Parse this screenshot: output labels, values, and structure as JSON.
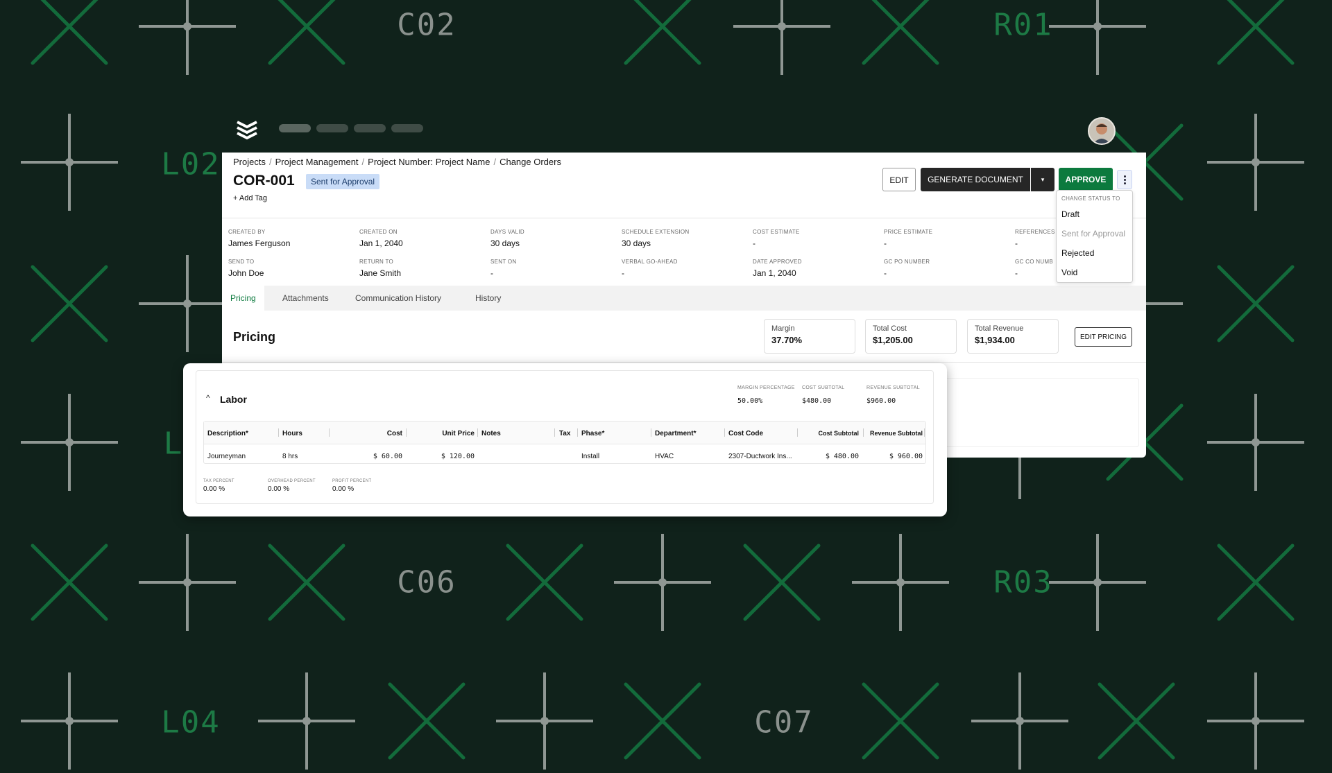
{
  "background": {
    "labels": [
      "C02",
      "R01",
      "L02",
      "L",
      "C06",
      "R03",
      "L04",
      "C07"
    ]
  },
  "nav": {
    "logo": "stack-logo-icon",
    "avatar": "user-avatar"
  },
  "breadcrumb": [
    "Projects",
    "Project Management",
    "Project Number: Project Name",
    "Change Orders"
  ],
  "breadcrumb_sep": "/",
  "header": {
    "title": "COR-001",
    "status": "Sent for Approval",
    "add_tag": "+ Add Tag"
  },
  "actions": {
    "edit": "EDIT",
    "generate": "GENERATE DOCUMENT",
    "generate_dropdown": "▾",
    "approve": "APPROVE"
  },
  "meta": [
    {
      "label": "CREATED BY",
      "value": "James Ferguson"
    },
    {
      "label": "CREATED ON",
      "value": "Jan 1, 2040"
    },
    {
      "label": "DAYS VALID",
      "value": "30 days"
    },
    {
      "label": "SCHEDULE EXTENSION",
      "value": "30 days"
    },
    {
      "label": "COST ESTIMATE",
      "value": "-"
    },
    {
      "label": "PRICE ESTIMATE",
      "value": "-"
    },
    {
      "label": "REFERENCES",
      "value": "-"
    },
    {
      "label": "SEND TO",
      "value": "John Doe"
    },
    {
      "label": "RETURN TO",
      "value": "Jane Smith"
    },
    {
      "label": "SENT ON",
      "value": "-"
    },
    {
      "label": "VERBAL GO-AHEAD",
      "value": "-"
    },
    {
      "label": "DATE APPROVED",
      "value": "Jan 1, 2040"
    },
    {
      "label": "GC PO NUMBER",
      "value": "-"
    },
    {
      "label": "GC CO NUMB",
      "value": "-"
    }
  ],
  "tabs": [
    "Pricing",
    "Attachments",
    "Communication History",
    "History"
  ],
  "pricing": {
    "title": "Pricing",
    "stats": [
      {
        "label": "Margin",
        "value": "37.70%"
      },
      {
        "label": "Total Cost",
        "value": "$1,205.00"
      },
      {
        "label": "Total Revenue",
        "value": "$1,934.00"
      }
    ],
    "edit_button": "EDIT PRICING"
  },
  "status_menu": {
    "header": "CHANGE STATUS TO",
    "items": [
      {
        "label": "Draft",
        "disabled": false
      },
      {
        "label": "Sent for Approval",
        "disabled": true
      },
      {
        "label": "Rejected",
        "disabled": false
      },
      {
        "label": "Void",
        "disabled": false
      }
    ]
  },
  "labor": {
    "title": "Labor",
    "chevron": "^",
    "subtotals": [
      {
        "label": "MARGIN PERCENTAGE",
        "value": "50.00%"
      },
      {
        "label": "COST SUBTOTAL",
        "value": "$480.00"
      },
      {
        "label": "REVENUE SUBTOTAL",
        "value": "$960.00"
      }
    ],
    "columns": [
      "Description*",
      "Hours",
      "Cost",
      "Unit Price",
      "Notes",
      "Tax",
      "Phase*",
      "Department*",
      "Cost Code",
      "Cost Subtotal",
      "Revenue Subtotal"
    ],
    "rows": [
      {
        "description": "Journeyman",
        "hours": "8 hrs",
        "cost": "$ 60.00",
        "unit_price": "$ 120.00",
        "notes": "",
        "tax": "",
        "phase": "Install",
        "department": "HVAC",
        "cost_code": "2307-Ductwork Ins...",
        "cost_subtotal": "$ 480.00",
        "revenue_subtotal": "$ 960.00"
      }
    ],
    "percents": [
      {
        "label": "TAX PERCENT",
        "value": "0.00 %"
      },
      {
        "label": "OVERHEAD PERCENT",
        "value": "0.00 %"
      },
      {
        "label": "PROFIT PERCENT",
        "value": "0.00 %"
      }
    ]
  }
}
